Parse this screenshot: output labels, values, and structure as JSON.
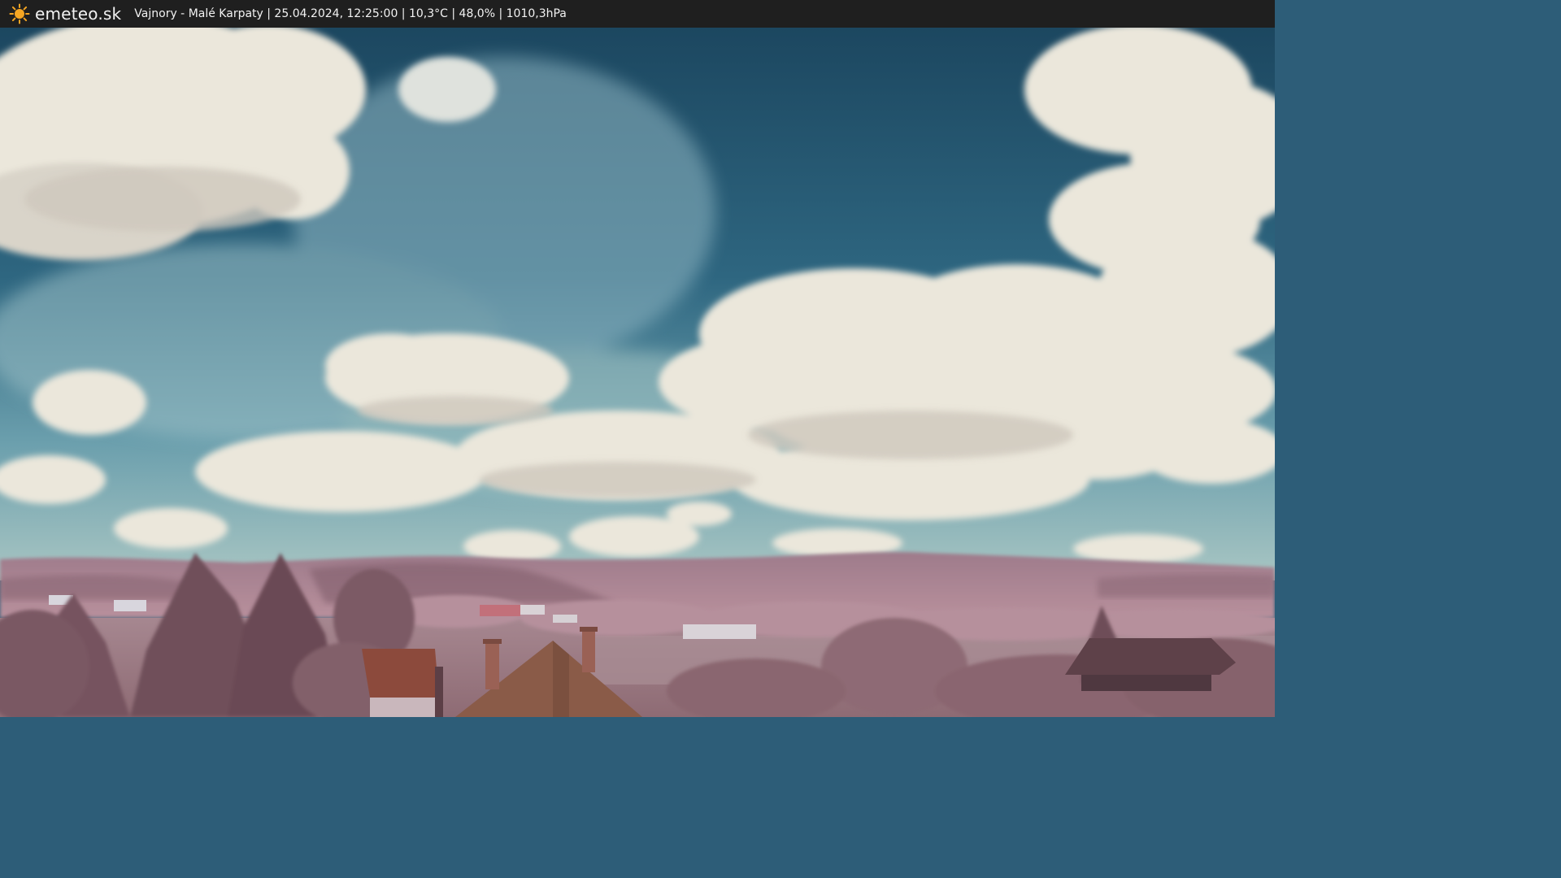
{
  "overlay": {
    "brand": "emeteo.sk",
    "caption": "Vajnory - Malé Karpaty | 25.04.2024, 12:25:00 | 10,3°C | 48,0% | 1010,3hPa",
    "logo_icon": "sun-icon"
  },
  "colors": {
    "bar_background": "#1f1f1f",
    "bar_text": "#f2f2f2",
    "sun": "#f5a623",
    "sky_deep": "#1f4a63",
    "sky_light": "#6fa6b3",
    "cloud": "#ece8dc",
    "hills": "#9c7584",
    "foliage": "#8a5f68",
    "roof": "#8a4a3a"
  }
}
